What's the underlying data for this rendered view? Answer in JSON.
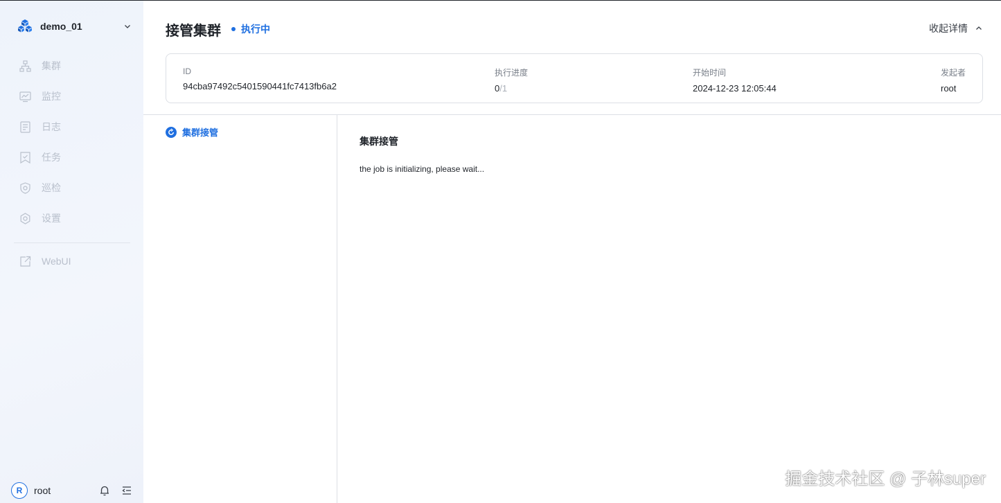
{
  "sidebar": {
    "cluster_name": "demo_01",
    "items": [
      {
        "label": "集群",
        "icon": "cluster-icon"
      },
      {
        "label": "监控",
        "icon": "monitor-icon"
      },
      {
        "label": "日志",
        "icon": "log-icon"
      },
      {
        "label": "任务",
        "icon": "task-icon"
      },
      {
        "label": "巡检",
        "icon": "inspection-icon"
      },
      {
        "label": "设置",
        "icon": "settings-icon"
      }
    ],
    "webui_label": "WebUI",
    "user": {
      "avatar_letter": "R",
      "name": "root"
    }
  },
  "header": {
    "title": "接管集群",
    "status": "执行中",
    "collapse_label": "收起详情"
  },
  "info": {
    "id_label": "ID",
    "id_value": "94cba97492c5401590441fc7413fb6a2",
    "progress_label": "执行进度",
    "progress_done": "0",
    "progress_total": "/1",
    "start_label": "开始时间",
    "start_value": "2024-12-23 12:05:44",
    "initiator_label": "发起者",
    "initiator_value": "root"
  },
  "steps": [
    {
      "label": "集群接管",
      "status": "running"
    }
  ],
  "detail": {
    "title": "集群接管",
    "message": "the job is initializing, please wait..."
  },
  "watermark": "掘金技术社区 @ 子林super",
  "colors": {
    "accent": "#1f6fe0",
    "nav_inactive": "#b9c0cc",
    "border": "#dcdfe5"
  }
}
